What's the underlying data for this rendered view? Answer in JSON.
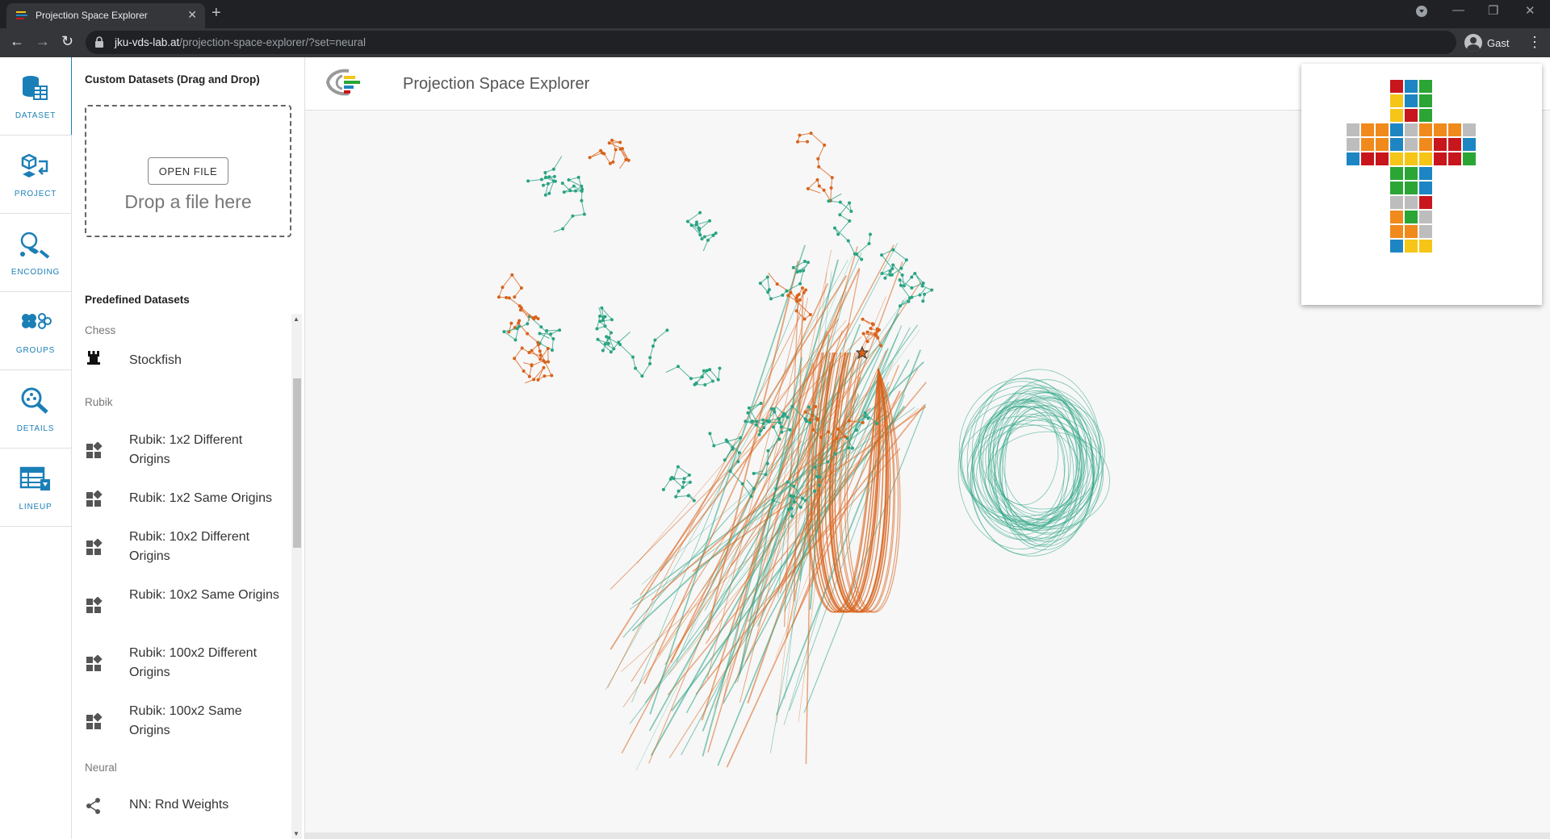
{
  "browser": {
    "tab_title": "Projection Space Explorer",
    "url_host": "jku-vds-lab.at",
    "url_path": "/projection-space-explorer/?set=neural",
    "profile_name": "Gast"
  },
  "rail": {
    "items": [
      {
        "label": "DATASET",
        "icon": "database-icon"
      },
      {
        "label": "PROJECT",
        "icon": "cube-project-icon"
      },
      {
        "label": "ENCODING",
        "icon": "brush-encoding-icon"
      },
      {
        "label": "GROUPS",
        "icon": "groups-icon"
      },
      {
        "label": "DETAILS",
        "icon": "magnifier-details-icon"
      },
      {
        "label": "LINEUP",
        "icon": "table-lineup-icon"
      }
    ]
  },
  "drawer": {
    "custom_heading": "Custom Datasets (Drag and Drop)",
    "open_file": "OPEN FILE",
    "drop_text": "Drop a file here",
    "predefined_heading": "Predefined Datasets",
    "categories": {
      "chess": "Chess",
      "rubik": "Rubik",
      "neural": "Neural"
    },
    "datasets": {
      "stockfish": "Stockfish",
      "r1": "Rubik: 1x2 Different Origins",
      "r2": "Rubik: 1x2 Same Origins",
      "r3": "Rubik: 10x2 Different Origins",
      "r4": "Rubik: 10x2 Same Origins",
      "r5": "Rubik: 100x2 Different Origins",
      "r6": "Rubik: 100x2 Same Origins",
      "nn": "NN: Rnd Weights"
    }
  },
  "app": {
    "title": "Projection Space Explorer"
  },
  "colors": {
    "accent": "#1b7fb7",
    "orange_trajectory": "#d9621a",
    "green_trajectory": "#2aa383",
    "cube_red": "#c8161d",
    "cube_blue": "#1d86c2",
    "cube_green": "#2ba534",
    "cube_yellow": "#f5c518",
    "cube_orange": "#f08a1c",
    "cube_gray": "#bdbdbd"
  }
}
